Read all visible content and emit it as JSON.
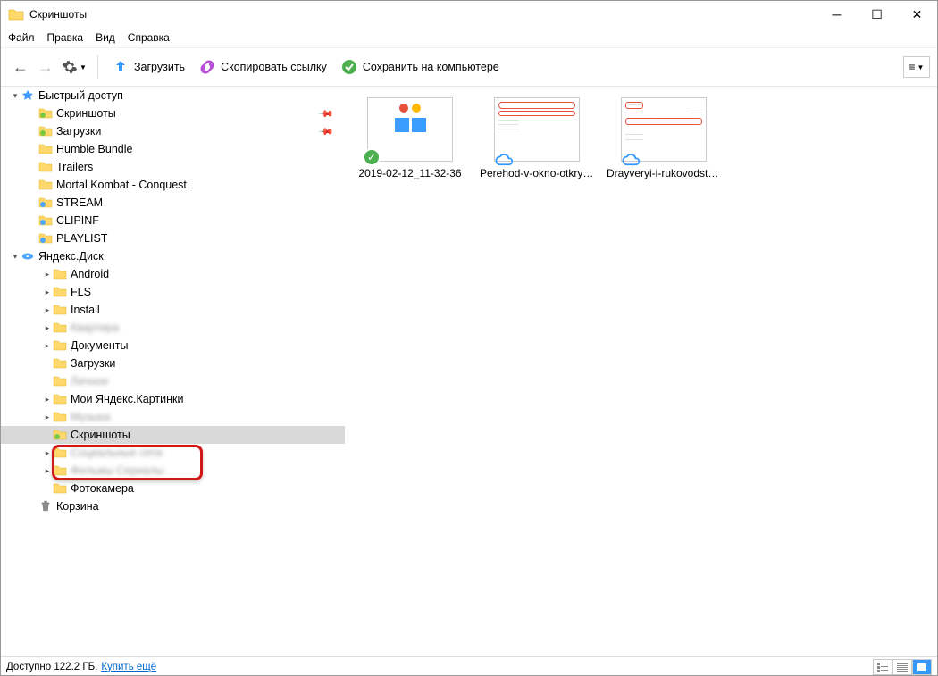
{
  "window": {
    "title": "Скриншоты"
  },
  "menu": {
    "file": "Файл",
    "edit": "Правка",
    "view": "Вид",
    "help": "Справка"
  },
  "toolbar": {
    "upload": "Загрузить",
    "copylink": "Скопировать ссылку",
    "save": "Сохранить на компьютере"
  },
  "sidebar": {
    "quick": {
      "label": "Быстрый доступ",
      "items": [
        {
          "label": "Скриншоты",
          "pin": true
        },
        {
          "label": "Загрузки",
          "pin": true
        },
        {
          "label": "Humble Bundle"
        },
        {
          "label": "Trailers"
        },
        {
          "label": "Mortal Kombat - Conquest"
        },
        {
          "label": "STREAM"
        },
        {
          "label": "CLIPINF"
        },
        {
          "label": "PLAYLIST"
        }
      ]
    },
    "yadisk": {
      "label": "Яндекс.Диск",
      "items": [
        {
          "label": "Android",
          "exp": true
        },
        {
          "label": "FLS",
          "exp": true
        },
        {
          "label": "Install",
          "exp": true
        },
        {
          "label": "Квартира",
          "exp": true,
          "blur": true
        },
        {
          "label": "Документы",
          "exp": true
        },
        {
          "label": "Загрузки"
        },
        {
          "label": "Личное",
          "blur": true
        },
        {
          "label": "Мои Яндекс.Картинки",
          "exp": true
        },
        {
          "label": "Музыка",
          "exp": true,
          "blur": true
        },
        {
          "label": "Скриншоты",
          "selected": true,
          "highlight": true
        },
        {
          "label": "Социальные сети",
          "exp": true,
          "blur": true
        },
        {
          "label": "Фильмы Сериалы",
          "exp": true,
          "blur": true
        },
        {
          "label": "Фотокамера"
        }
      ]
    },
    "trash": {
      "label": "Корзина"
    }
  },
  "files": [
    {
      "name": "2019-02-12_11-32-36",
      "badge": "green"
    },
    {
      "name": "Perehod-v-okno-otkryiti...",
      "badge": "cloud"
    },
    {
      "name": "Drayveryi-i-rukovodstvo...",
      "badge": "cloud"
    }
  ],
  "status": {
    "available": "Доступно 122.2 ГБ.",
    "buymore": "Купить ещё"
  }
}
